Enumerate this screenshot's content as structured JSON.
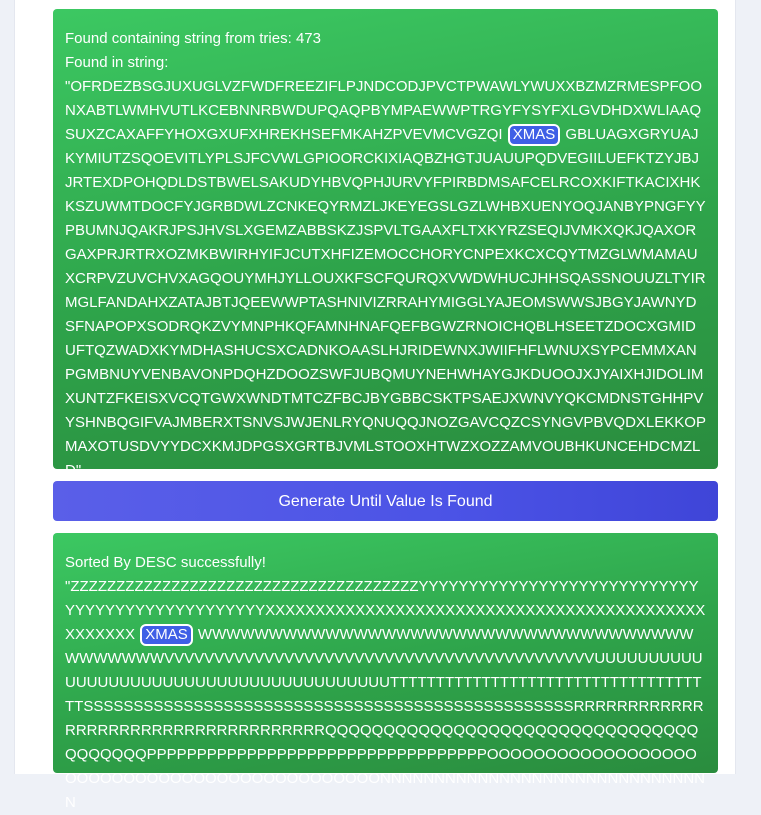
{
  "result": {
    "found_label": "Found containing string from tries:",
    "tries": "473",
    "found_in_label": "Found in string:",
    "string_before": "\"OFRDEZBSGJUXUGLVZFWDFREEZIFLPJNDCODJPVCTPWAWLYWUXXBZMZRMESPFOONXABTLWMHVUTLKCEBNNRBWDUPQAQPBYMPAEWWPTRGYFYSYFXLGVDHDXWLIAAQSUXZCAXAFFYHOXGXUFXHREKHSEFMKAHZPVEVMCVGZQI",
    "highlight": "XMAS",
    "string_after": "GBLUAGXGRYUAJKYMIUTZSQOEVITLYPLSJFCVWLGPIOORCKIXIAQBZHGTJUAUUPQDVEGIILUEFKTZYJBJJRTEXDPOHQDLDSTBWELSAKUDYHBVQPHJURVYFPIRBDMSAFCELRCOXKIFTKACIXHKKSZUWMTDOCFYJGRBDWLZCNKEQYRMZLJKEYEGSLGZLWHBXUENYOQJANBYPNGFYYPBUMNJQAKRJPSJHVSLXGEMZABBSKZJSPVLTGAAXFLTXKYRZSEQIJVMKXQKJQAXORGAXPRJRTRXOZMKBWIRHYIFJCUTXHFIZEMOCCHORYCNPEXKCXCQYTMZGLWMAMAUXCRPVZUVCHVXAGQOUYMHJYLLOUXKFSCFQURQXVWDWHUCJHHSQASSNOUUZLTYIRMGLFANDAHXZATAJBTJQEEWWPTASHNIVIZRRAHYMIGGLYAJEOMSWWSJBGYJAWNYDSFNAPOPXSODRQKZVYMNPHKQFAMNHNAFQEFBGWZRNOICHQBLHSEETZDOCXGMIDUFTQZWADXKYMDHASHUCSXCADNKOAASLHJRIDEWNXJWIIFHFLWNUXSYPCEMMXANPGMBNUYVENBAVONPDQHZDOOZSWFJUBQMUYNEHWHAYGJKDUOOJXJYAIXHJIDOLIMXUNTZFKEISXVCQTGWXWNDTMTCZFBCJBYGBBCSKTPSAEJXWNVYQKCMDNSTGHHPVYSHNBQGIFVAJMBERXTSNVSJWJENLRYQNUQQJNOZGAVCQZCSYNGVPBVQDXLEKKOPMAXOTUSDVYYDCXKMJDPGSXGRTBJVMLSTOOXHTWZXOZZAMVOUBHKUNCEHDCMZLD\""
  },
  "button": {
    "label": "Generate Until Value Is Found"
  },
  "sorted": {
    "status": "Sorted By DESC successfully!",
    "string_before": "\"ZZZZZZZZZZZZZZZZZZZZZZZZZZZZZZZZZZZZZZYYYYYYYYYYYYYYYYYYYYYYYYYYYYYYYYYYYYYYYYYYYYYYYYXXXXXXXXXXXXXXXXXXXXXXXXXXXXXXXXXXXXXXXXXXXXXXXXXXX",
    "highlight": "XMAS",
    "string_after": "WWWWWWWWWWWWWWWWWWWWWWWWWWWWWWWWWWWWWWWWWWVVVVVVVVVVVVVVVVVVVVVVVVVVVVVVVVVVVVVVVVVVVUUUUUUUUUUUUUUUUUUUUUUUUUUUUUUUUUUUUUUUUTTTTTTTTTTTTTTTTTTTTTTTTTTTTTTTTTTTTSSSSSSSSSSSSSSSSSSSSSSSSSSSSSSSSSSSSSSSSSSSSSSSSSRRRRRRRRRRRRRRRRRRRRRRRRRRRRRRRRRRRRQQQQQQQQQQQQQQQQQQQQQQQQQQQQQQQQQQQQQQQPPPPPPPPPPPPPPPPPPPPPPPPPPPPPPPPPPOOOOOOOOOOOOOOOOOOOOOOOOOOOOOOOOOOOOOOOOOOOOONNNNNNNNNNNNNNNNNNNNNNNNNNNNNNN"
  },
  "colors": {
    "panel_green": "#2ea34a",
    "button_blue": "#4b53e6",
    "highlight_blue": "#3f5fe6"
  }
}
